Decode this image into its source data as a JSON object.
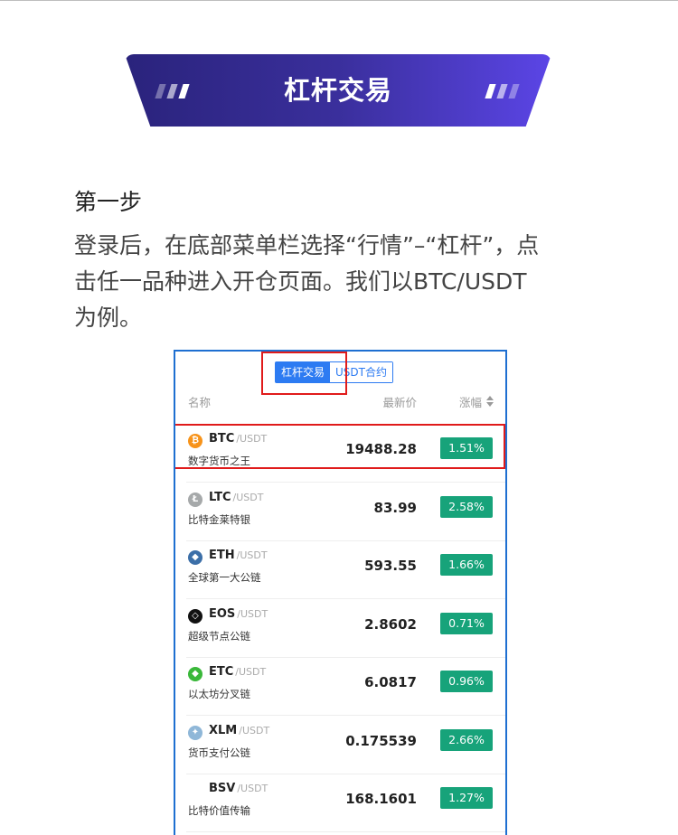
{
  "banner": {
    "title": "杠杆交易"
  },
  "step": {
    "title": "第一步",
    "line1": "登录后，在底部菜单栏选择“行情”–“杠杆”，点",
    "line2": "击任一品种进入开仓页面。我们以BTC/USDT",
    "line3": "为例。"
  },
  "screenshot": {
    "tabs": [
      {
        "label": "杠杆交易",
        "active": true
      },
      {
        "label": "USDT合约",
        "active": false
      }
    ],
    "columns": {
      "name": "名称",
      "price": "最新价",
      "change": "涨幅"
    },
    "rows": [
      {
        "symbol": "BTC",
        "pair": "/USDT",
        "name": "数字货币之王",
        "price": "19488.28",
        "change": "1.51%",
        "icon": "btc-icon",
        "color": "#f7931a"
      },
      {
        "symbol": "LTC",
        "pair": "/USDT",
        "name": "比特金莱特银",
        "price": "83.99",
        "change": "2.58%",
        "icon": "ltc-icon",
        "color": "#a6a9aa"
      },
      {
        "symbol": "ETH",
        "pair": "/USDT",
        "name": "全球第一大公链",
        "price": "593.55",
        "change": "1.66%",
        "icon": "eth-icon",
        "color": "#3c6fa8"
      },
      {
        "symbol": "EOS",
        "pair": "/USDT",
        "name": "超级节点公链",
        "price": "2.8602",
        "change": "0.71%",
        "icon": "eos-icon",
        "color": "#111111"
      },
      {
        "symbol": "ETC",
        "pair": "/USDT",
        "name": "以太坊分叉链",
        "price": "6.0817",
        "change": "0.96%",
        "icon": "etc-icon",
        "color": "#3ab83a"
      },
      {
        "symbol": "XLM",
        "pair": "/USDT",
        "name": "货币支付公链",
        "price": "0.175539",
        "change": "2.66%",
        "icon": "xlm-icon",
        "color": "#8fb7d8"
      },
      {
        "symbol": "BSV",
        "pair": "/USDT",
        "name": "比特价值传输",
        "price": "168.1601",
        "change": "1.27%",
        "icon": "",
        "color": ""
      }
    ],
    "accent_color": "#2d7bf2",
    "change_color": "#17a37a",
    "highlight_color": "#e01b1b"
  }
}
